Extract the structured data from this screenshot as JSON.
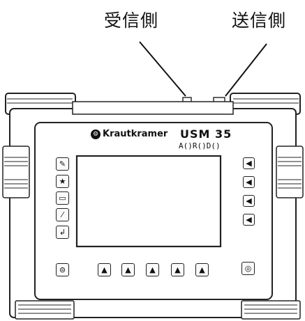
{
  "labels": {
    "receiver": "受信側",
    "transmitter": "送信側"
  },
  "device": {
    "brand": "Krautkramer",
    "model": "USM 35",
    "submodel": "A()R()D()"
  },
  "icons": {
    "left_keys": [
      "pencil-icon",
      "star-icon",
      "display-icon",
      "brush-icon",
      "enter-icon"
    ],
    "right_keys": [
      "speaker-icon",
      "speaker-icon",
      "speaker-icon",
      "speaker-icon"
    ],
    "bottom_keys": [
      "menu-icon",
      "arrow-up-icon",
      "arrow-up-icon",
      "arrow-up-icon",
      "arrow-up-icon",
      "arrow-up-icon",
      "power-icon"
    ]
  }
}
